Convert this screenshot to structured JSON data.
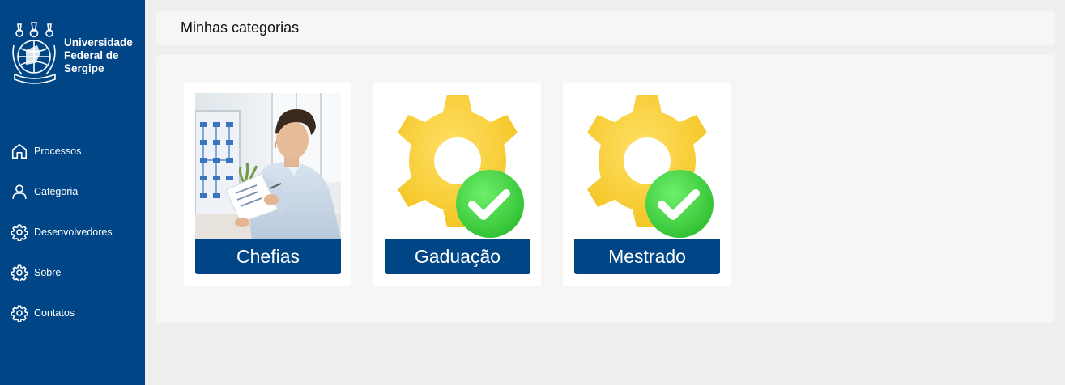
{
  "brand": {
    "lines": [
      "Universidade",
      "Federal de",
      "Sergipe"
    ],
    "color": "#004585"
  },
  "nav": {
    "items": [
      {
        "label": "Processos",
        "icon": "home-icon"
      },
      {
        "label": "Categoria",
        "icon": "user-icon"
      },
      {
        "label": "Desenvolvedores",
        "icon": "gear-icon"
      },
      {
        "label": "Sobre",
        "icon": "gear-icon"
      },
      {
        "label": "Contatos",
        "icon": "gear-icon"
      }
    ]
  },
  "page": {
    "title": "Minhas categorias"
  },
  "categories": [
    {
      "label": "Chefias",
      "image": "man-reading-document-photo"
    },
    {
      "label": "Gaduação",
      "image": "gear-checkmark-icon"
    },
    {
      "label": "Mestrado",
      "image": "gear-checkmark-icon"
    }
  ]
}
